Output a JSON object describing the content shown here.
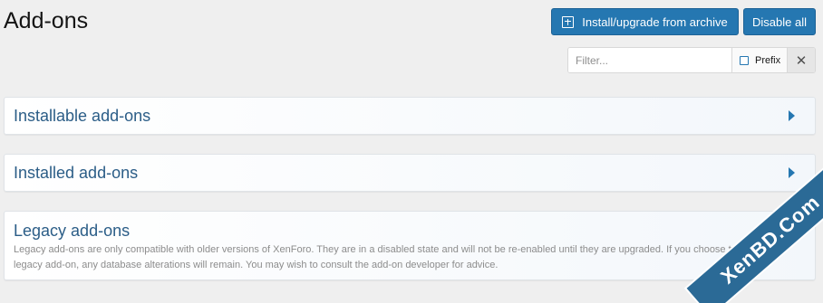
{
  "page": {
    "title": "Add-ons"
  },
  "actions": {
    "install_label": "Install/upgrade from archive",
    "disable_label": "Disable all"
  },
  "filter": {
    "placeholder": "Filter...",
    "prefix_label": "Prefix",
    "clear_glyph": "✕"
  },
  "blocks": {
    "installable": {
      "title": "Installable add-ons"
    },
    "installed": {
      "title": "Installed add-ons"
    },
    "legacy": {
      "title": "Legacy add-ons",
      "description": "Legacy add-ons are only compatible with older versions of XenForo. They are in a disabled state and will not be re-enabled until they are upgraded. If you choose to uninstall a legacy add-on, any database alterations will remain. You may wish to consult the add-on developer for advice."
    }
  },
  "watermark": {
    "text": "XenBD.Com"
  },
  "colors": {
    "accent": "#2577b1",
    "title": "#2b5d87"
  }
}
